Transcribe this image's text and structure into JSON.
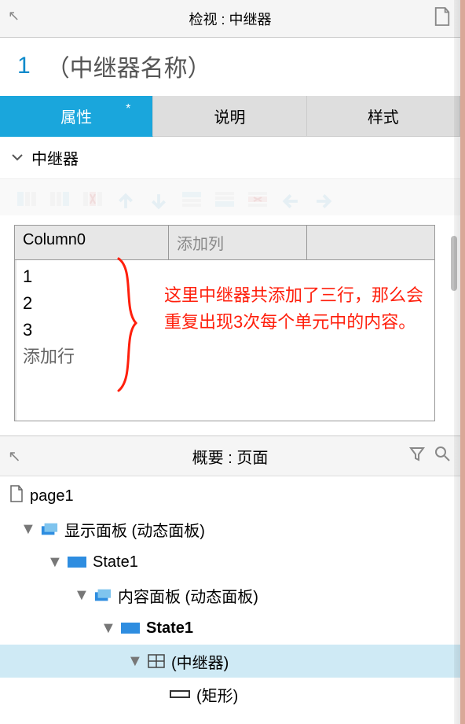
{
  "inspector": {
    "title": "检视 : 中继器",
    "widget_index": "1",
    "widget_name": "（中继器名称）",
    "tabs": {
      "props": "属性",
      "notes": "说明",
      "style": "样式",
      "dirty_mark": "*"
    },
    "section": "中继器",
    "grid": {
      "col0": "Column0",
      "add_col": "添加列",
      "rows": [
        "1",
        "2",
        "3"
      ],
      "add_row": "添加行"
    },
    "annotation": "这里中继器共添加了三行，那么会重复出现3次每个单元中的内容。"
  },
  "outline": {
    "title": "概要 : 页面",
    "page": "page1",
    "nodes": {
      "panel1": "显示面板 (动态面板)",
      "state1a": "State1",
      "panel2": "内容面板 (动态面板)",
      "state1b": "State1",
      "repeater": "(中继器)",
      "rect": "(矩形)"
    }
  }
}
